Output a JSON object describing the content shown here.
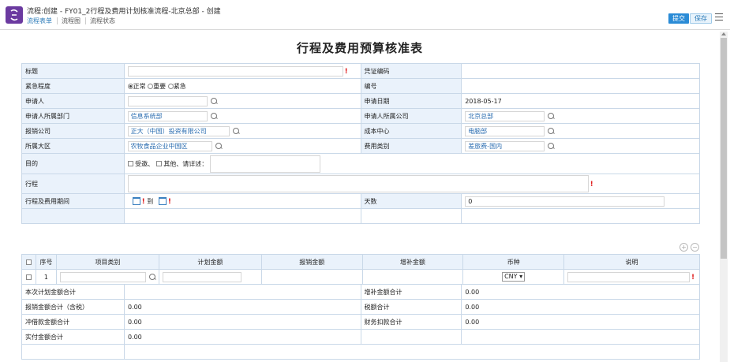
{
  "header": {
    "title": "流程:创建 - FY01_2行程及费用计划核准流程-北京总部 - 创建",
    "tabs": [
      "流程表单",
      "流程图",
      "流程状态"
    ],
    "submit_label": "提交",
    "save_label": "保存"
  },
  "form": {
    "title": "行程及费用预算核准表",
    "labels": {
      "subject": "标题",
      "voucher": "凭证编码",
      "urgency": "紧急程度",
      "number": "编号",
      "applicant": "申请人",
      "apply_date": "申请日期",
      "dept": "申请人所属部门",
      "company": "申请人所属公司",
      "reimb_company": "报销公司",
      "cost_center": "成本中心",
      "region": "所属大区",
      "expense_type": "费用类别",
      "purpose": "目的",
      "itinerary": "行程",
      "period": "行程及费用期间",
      "days": "天数"
    },
    "values": {
      "apply_date": "2018-05-17",
      "dept": "信息系统部",
      "company": "北京总部",
      "reimb_company": "正大（中国）投资有限公司",
      "cost_center": "电脑部",
      "region": "农牧食品企业中国区",
      "expense_type": "差旅费-国内",
      "days": "0",
      "to": "到"
    },
    "urgency_options": [
      "正常",
      "重要",
      "紧急"
    ],
    "purpose_options": [
      "受邀、",
      "其他、请详述："
    ]
  },
  "detail": {
    "columns": [
      "序号",
      "项目类别",
      "计划金额",
      "报销金额",
      "增补金额",
      "币种",
      "说明"
    ],
    "row": {
      "index": "1",
      "currency": "CNY ▾"
    },
    "summary": {
      "plan_total_label": "本次计划金额合计",
      "plan_total": "",
      "add_total_label": "增补金额合计",
      "add_total": "0.00",
      "reimb_total_label": "报销金额合计（含税）",
      "reimb_total": "0.00",
      "tax_total_label": "税额合计",
      "tax_total": "0.00",
      "loan_total_label": "冲借款金额合计",
      "loan_total": "0.00",
      "deduct_total_label": "财务扣款合计",
      "deduct_total": "0.00",
      "actual_total_label": "实付金额合计",
      "actual_total": "0.00"
    }
  },
  "colors": {
    "accent": "#2a8bd6",
    "label_bg": "#eaf2fb",
    "logo": "#6b3aa0",
    "required": "#e02020"
  }
}
